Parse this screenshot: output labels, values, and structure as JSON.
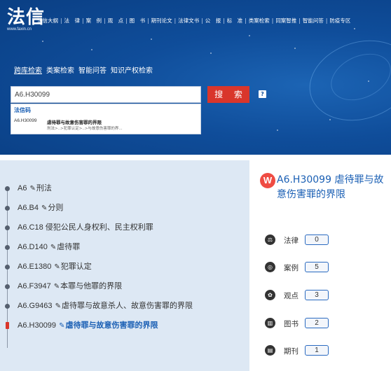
{
  "header": {
    "logo_text": "法信",
    "logo_url": "www.faxin.cn",
    "nav": [
      "法信大纲",
      "法　律",
      "案　例",
      "观　点",
      "图　书",
      "期刊论文",
      "法律文书",
      "公　报",
      "标　准",
      "类案检索",
      "同案智推",
      "智能问答",
      "防疫专区"
    ],
    "sub_tabs": [
      "跨库检索",
      "类案检索",
      "智能问答",
      "知识产权检索"
    ],
    "active_sub_tab": "跨库检索"
  },
  "search": {
    "value": "A6.H30099",
    "button_label": "搜 索",
    "help_label": "?"
  },
  "suggestion": {
    "heading": "法信码",
    "code": "A6.H30099",
    "title": "虐待罪与故意伤害罪的界限",
    "path": "刑法>..>犯罪认定>..>与故意伤害罪的界..."
  },
  "tree": [
    {
      "code": "A6",
      "label": "刑法",
      "active": false
    },
    {
      "code": "A6.B4",
      "label": "分则",
      "active": false
    },
    {
      "code": "A6.C18",
      "label": "侵犯公民人身权利、民主权利罪",
      "active": false,
      "pencil": false
    },
    {
      "code": "A6.D140",
      "label": "虐待罪",
      "active": false
    },
    {
      "code": "A6.E1380",
      "label": "犯罪认定",
      "active": false
    },
    {
      "code": "A6.F3947",
      "label": "本罪与他罪的界限",
      "active": false
    },
    {
      "code": "A6.G9463",
      "label": "虐待罪与故意杀人、故意伤害罪的界限",
      "active": false
    },
    {
      "code": "A6.H30099",
      "label": "虐待罪与故意伤害罪的界限",
      "active": true
    }
  ],
  "side": {
    "title": "A6.H30099 虐待罪与故意伤害罪的界限",
    "stats": [
      {
        "label": "法律",
        "count": "0",
        "icon": "scale-icon"
      },
      {
        "label": "案例",
        "count": "5",
        "icon": "case-icon"
      },
      {
        "label": "观点",
        "count": "3",
        "icon": "opinion-icon"
      },
      {
        "label": "图书",
        "count": "2",
        "icon": "book-icon"
      },
      {
        "label": "期刊",
        "count": "1",
        "icon": "journal-icon"
      }
    ]
  },
  "colors": {
    "banner": "#0f4d9a",
    "accent_red": "#d9362b",
    "link_blue": "#1a5fb4",
    "tree_bg": "#dde8f4"
  }
}
